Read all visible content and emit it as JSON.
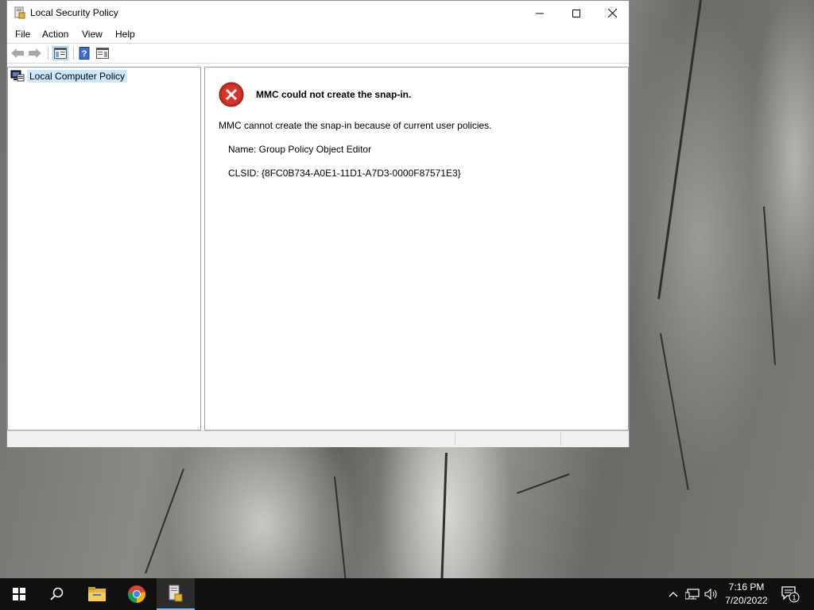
{
  "window": {
    "title": "Local Security Policy"
  },
  "menu": {
    "items": [
      "File",
      "Action",
      "View",
      "Help"
    ]
  },
  "tree": {
    "root_label": "Local Computer Policy"
  },
  "error": {
    "heading": "MMC could not create the snap-in.",
    "message": "MMC cannot create the snap-in because of current user policies.",
    "name_line": "Name: Group Policy Object Editor",
    "clsid_line": "CLSID: {8FC0B734-A0E1-11D1-A7D3-0000F87571E3}"
  },
  "taskbar": {
    "time": "7:16 PM",
    "date": "7/20/2022",
    "notification_count": "1"
  },
  "colors": {
    "selection": "#cce8ff",
    "error_red": "#c42b1c",
    "taskbar": "#101010",
    "active_underline": "#76b9ed"
  }
}
